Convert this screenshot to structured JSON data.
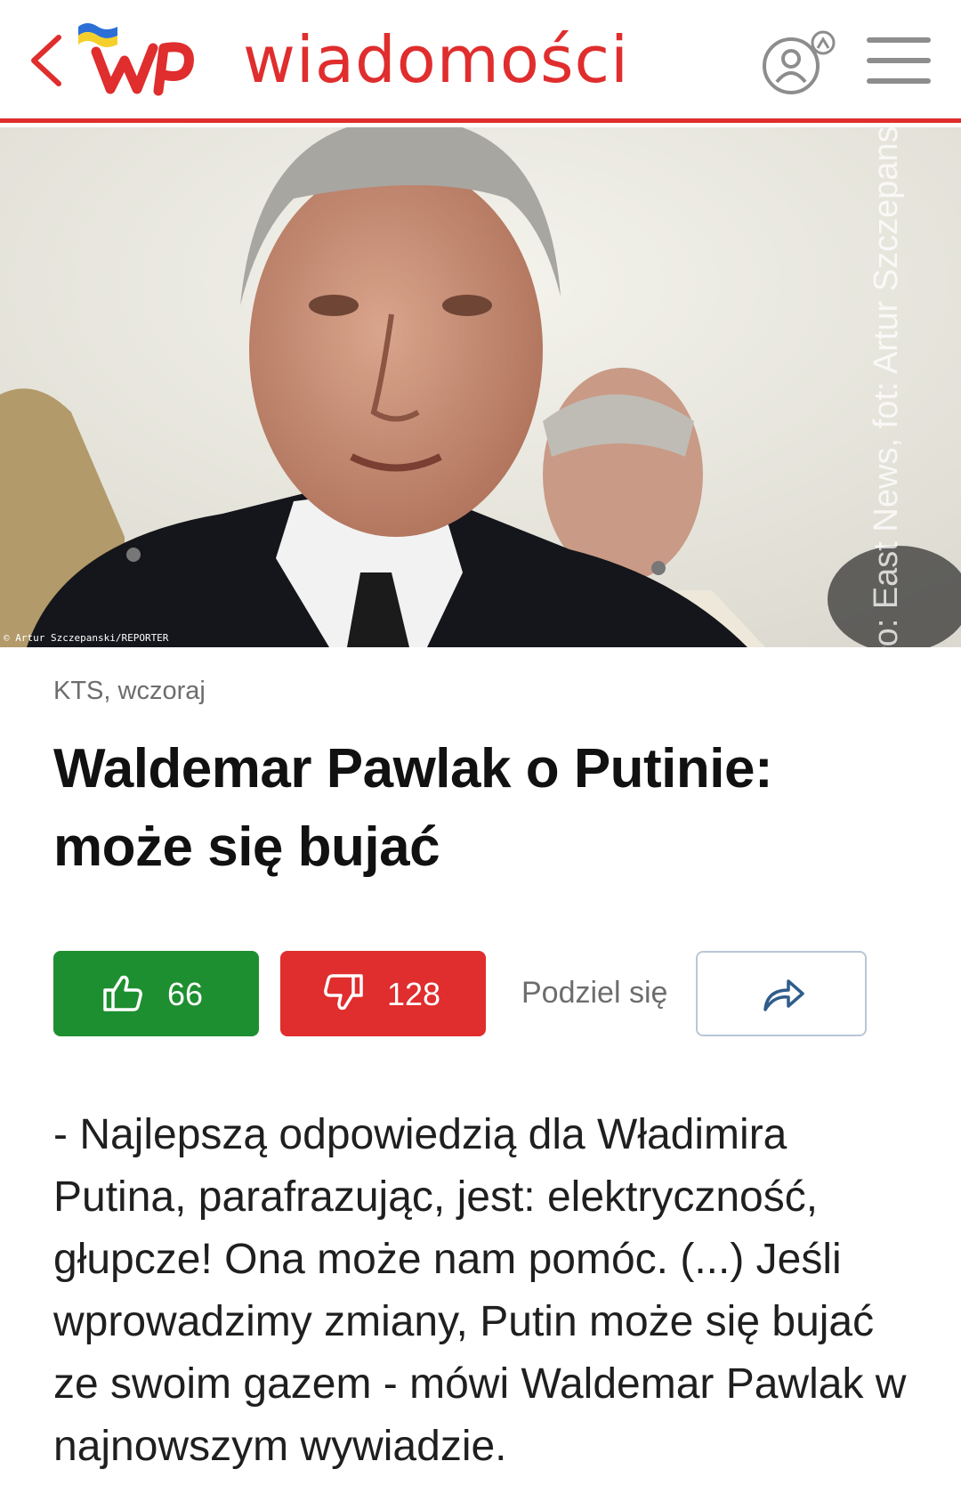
{
  "header": {
    "brand": "wiadomości",
    "back_icon": "chevron-left-icon",
    "logo_icon": "wp-logo-icon",
    "profile_icon": "user-profile-icon",
    "menu_icon": "hamburger-menu-icon",
    "accent_color": "#e02d2d"
  },
  "hero": {
    "photo_credit": "Źródło: East News, fot: Artur Szczepanski/REPORTER",
    "photo_tag": "© Artur Szczepanski/REPORTER"
  },
  "article": {
    "meta": "KTS, wczoraj",
    "title": "Waldemar Pawlak o Putinie: może się bujać",
    "body": "- Najlepszą odpowiedzią dla Władimira Putina, parafrazując, jest: elektryczność, głupcze! Ona może nam pomóc. (...) Jeśli wprowadzimy zmiany, Putin może się bujać ze swoim gazem - mówi Waldemar Pawlak w najnowszym wywiadzie."
  },
  "reactions": {
    "like_count": "66",
    "dislike_count": "128",
    "share_label": "Podziel się",
    "like_color": "#1e8f30",
    "dislike_color": "#e02d2d"
  }
}
